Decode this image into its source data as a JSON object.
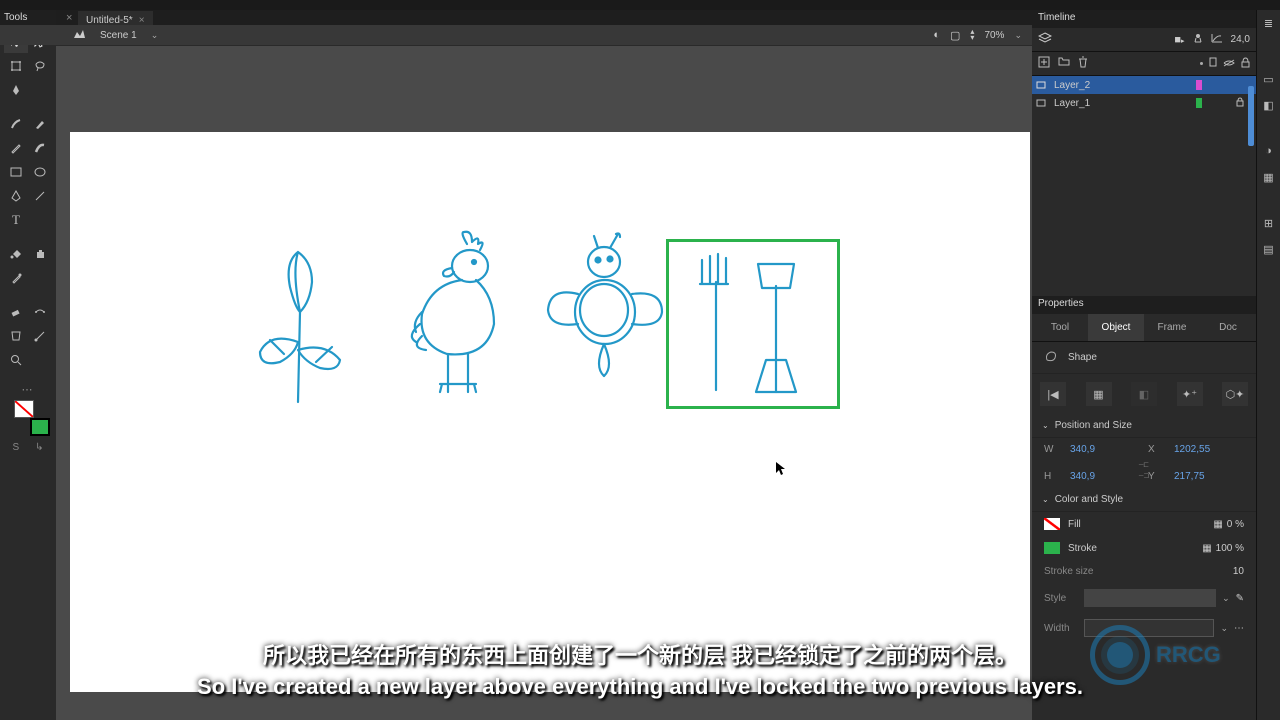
{
  "document": {
    "tab_title": "Untitled-5*"
  },
  "scene": {
    "name": "Scene 1",
    "zoom": "70%"
  },
  "tools": {
    "panel_title": "Tools"
  },
  "timeline": {
    "panel_title": "Timeline",
    "fps_partial": "24,0",
    "layers": [
      {
        "name": "Layer_2",
        "color": "#d94dd0",
        "locked": false,
        "selected": true
      },
      {
        "name": "Layer_1",
        "color": "#2bb24c",
        "locked": true,
        "selected": false
      }
    ]
  },
  "properties": {
    "panel_title": "Properties",
    "tabs": {
      "tool": "Tool",
      "object": "Object",
      "frame": "Frame",
      "doc": "Doc"
    },
    "shape_label": "Shape",
    "section_pos": "Position and Size",
    "w_label": "W",
    "h_label": "H",
    "x_label": "X",
    "y_label": "Y",
    "w_val": "340,9",
    "h_val": "340,9",
    "x_val": "1202,55",
    "y_val": "217,75",
    "section_color": "Color and Style",
    "fill_label": "Fill",
    "fill_pct": "0 %",
    "stroke_label": "Stroke",
    "stroke_pct": "100 %",
    "stroke_color": "#2bb24c",
    "stroke_size_label": "Stroke size",
    "stroke_size_val": "10",
    "style_label": "Style",
    "width_label": "Width"
  },
  "color_swatches": {
    "stroke": "none",
    "fill": "#2bb24c"
  },
  "subtitle": {
    "cn": "所以我已经在所有的东西上面创建了一个新的层 我已经锁定了之前的两个层。",
    "en": "So I've created a new layer above everything and I've locked the two previous layers."
  },
  "mini_row": {
    "s": "S",
    "arrow": "↳"
  }
}
